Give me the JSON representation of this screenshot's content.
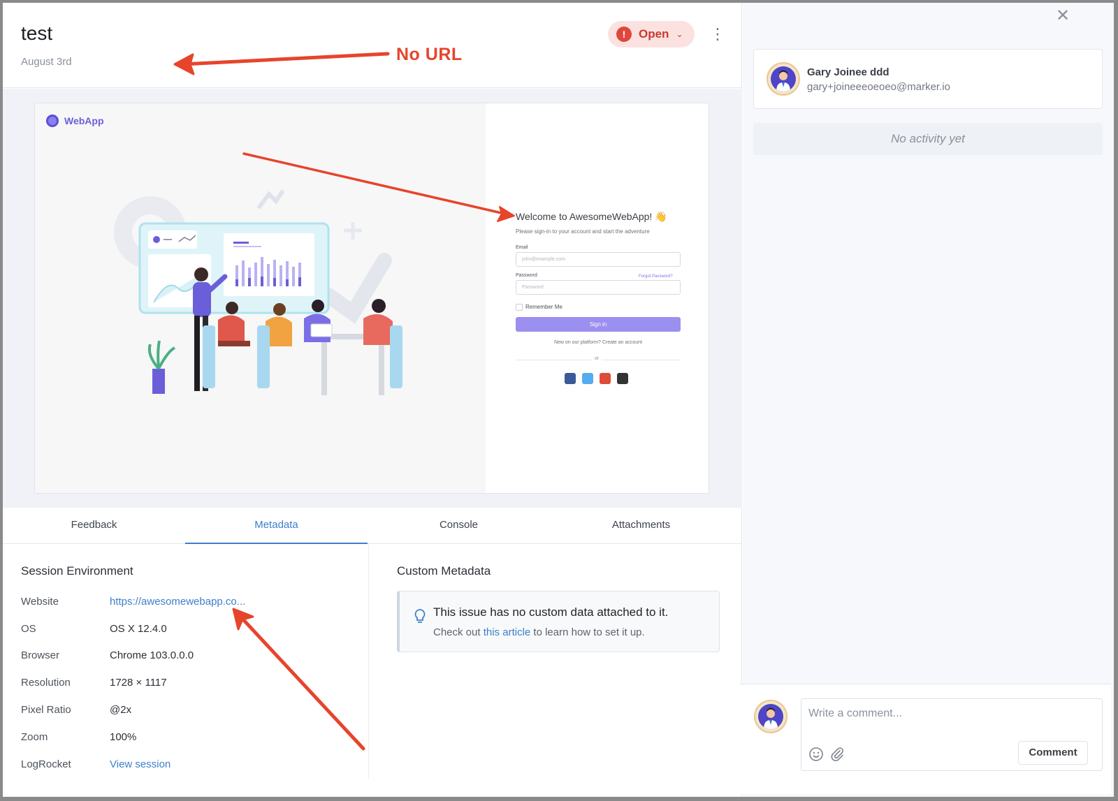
{
  "issue": {
    "title": "test",
    "date": "August 3rd",
    "status": "Open",
    "status_icon": "exclamation-icon",
    "annotation": "No URL"
  },
  "screenshot": {
    "logo_text": "WebApp",
    "welcome_title": "Welcome to AwesomeWebApp! 👋",
    "welcome_sub": "Please sign-in to your account and start the adventure",
    "email_label": "Email",
    "email_placeholder": "john@example.com",
    "password_label": "Password",
    "forgot_label": "Forgot Password?",
    "password_placeholder": "Password",
    "remember_label": "Remember Me",
    "signin_label": "Sign in",
    "new_account": "New on our platform? Create an account",
    "or_label": "or",
    "social_colors": [
      "#3b5998",
      "#55acee",
      "#dd4b39",
      "#333333"
    ]
  },
  "tabs": [
    "Feedback",
    "Metadata",
    "Console",
    "Attachments"
  ],
  "active_tab": "Metadata",
  "session": {
    "heading": "Session Environment",
    "rows": [
      {
        "key": "Website",
        "value": "https://awesomewebapp.co..."
      },
      {
        "key": "OS",
        "value": "OS X 12.4.0"
      },
      {
        "key": "Browser",
        "value": "Chrome 103.0.0.0"
      },
      {
        "key": "Resolution",
        "value": "1728 × 1117"
      },
      {
        "key": "Pixel Ratio",
        "value": "@2x"
      },
      {
        "key": "Zoom",
        "value": "100%"
      },
      {
        "key": "LogRocket",
        "value": "View session"
      }
    ]
  },
  "custom": {
    "heading": "Custom Metadata",
    "message": "This issue has no custom data attached to it.",
    "help_prefix": "Check out ",
    "help_link": "this article",
    "help_suffix": " to learn how to set it up."
  },
  "reporter": {
    "name": "Gary Joinee ddd",
    "email": "gary+joineeeoeoeo@marker.io"
  },
  "activity": {
    "empty": "No activity yet"
  },
  "comment": {
    "placeholder": "Write a comment...",
    "button": "Comment"
  },
  "colors": {
    "accent": "#3d7fc9",
    "status": "#e0473b",
    "annotation": "#e7442c"
  }
}
